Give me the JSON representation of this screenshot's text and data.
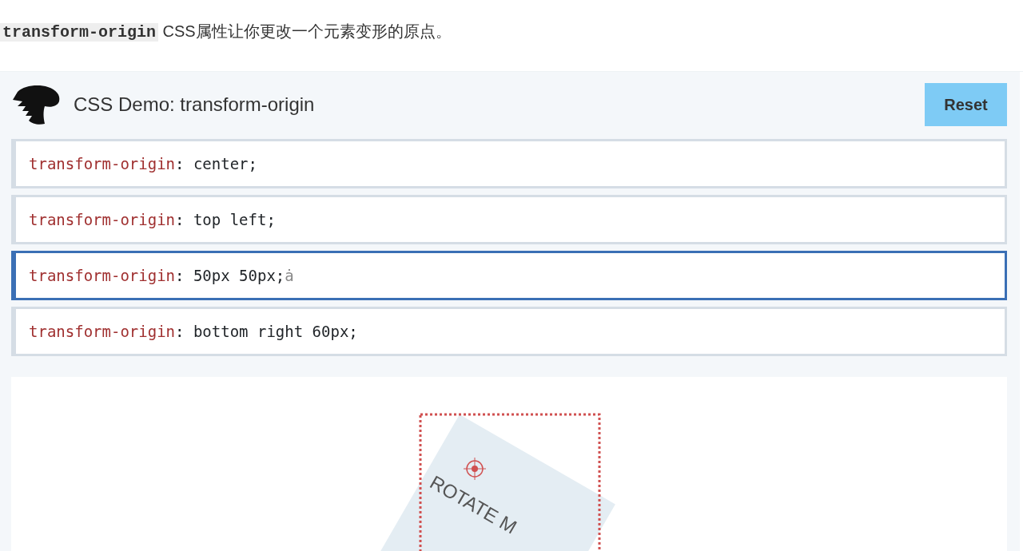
{
  "intro": {
    "code": "transform-origin",
    "text": "CSS属性让你更改一个元素变形的原点。"
  },
  "demo": {
    "title": "CSS Demo: transform-origin",
    "reset": "Reset",
    "options": [
      {
        "property": "transform-origin",
        "value": ": center;",
        "selected": false
      },
      {
        "property": "transform-origin",
        "value": ": top left;",
        "selected": false
      },
      {
        "property": "transform-origin",
        "value": ": 50px 50px;",
        "selected": true,
        "cursor_mark": "ȧ"
      },
      {
        "property": "transform-origin",
        "value": ": bottom right 60px;",
        "selected": false
      }
    ],
    "output": {
      "label": "ROTATE M"
    }
  }
}
